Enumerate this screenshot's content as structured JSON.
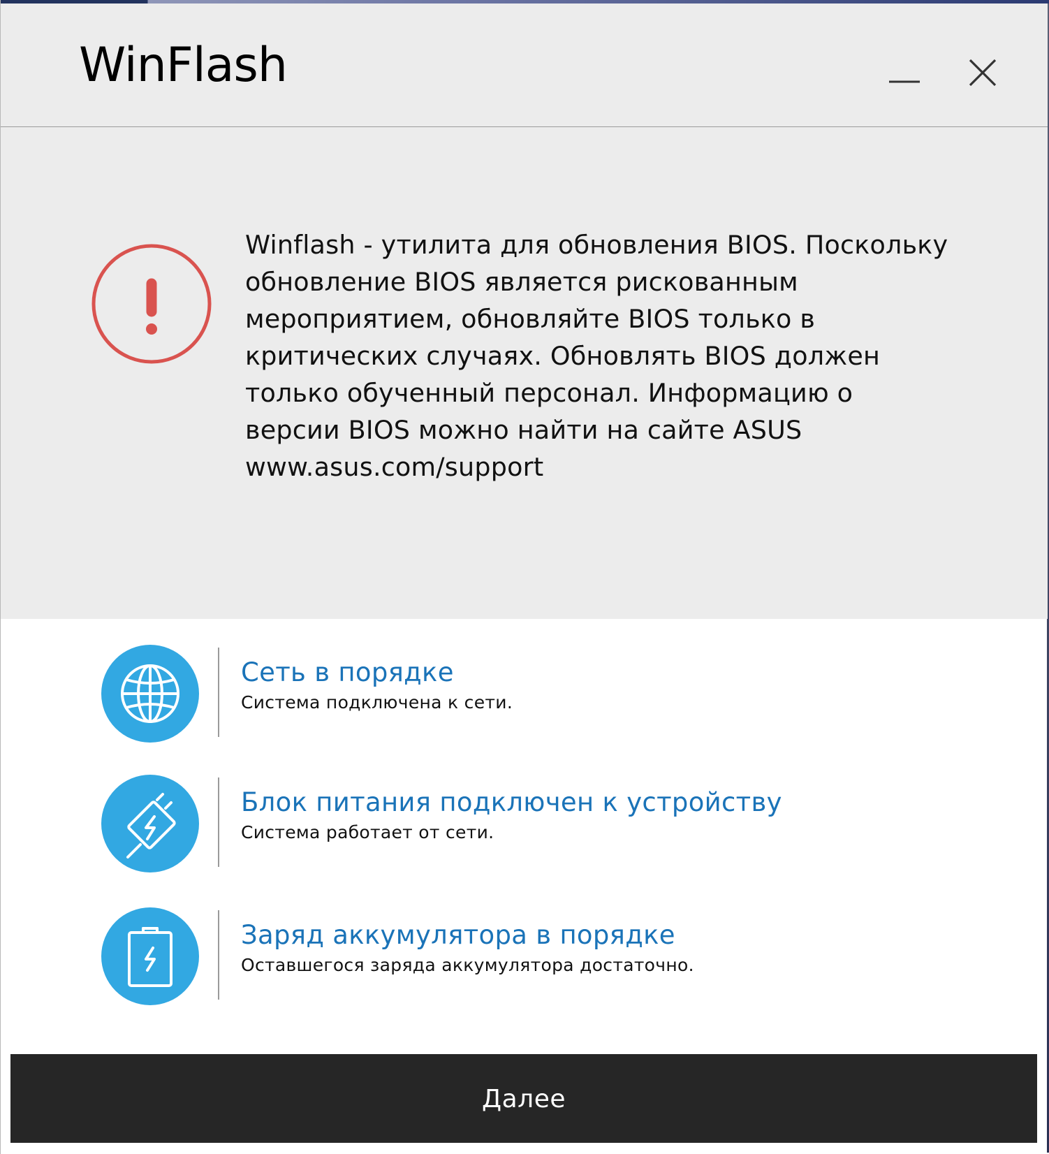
{
  "window": {
    "title": "WinFlash",
    "minimize_icon": "minimize-icon",
    "close_icon": "close-icon"
  },
  "warning": {
    "icon": "exclamation-circle-icon",
    "icon_color": "#d9534f",
    "text": "Winflash - утилита для обновления BIOS. Поскольку\nобновление BIOS является рискованным\nмероприятием, обновляйте BIOS только в\nкритических случаях. Обновлять BIOS должен\nтолько обученный персонал. Информацию о\nверсии BIOS можно найти на сайте ASUS\nwww.asus.com/support"
  },
  "status": {
    "accent_color": "#32a8e2",
    "title_color": "#1a73b8",
    "items": [
      {
        "icon": "globe-icon",
        "title": "Сеть в порядке",
        "description": "Система подключена к сети."
      },
      {
        "icon": "power-adapter-icon",
        "title": "Блок питания подключен к устройству",
        "description": "Система работает от сети."
      },
      {
        "icon": "battery-charging-icon",
        "title": "Заряд аккумулятора в порядке",
        "description": "Оставшегося заряда аккумулятора достаточно."
      }
    ]
  },
  "footer": {
    "next_label": "Далее"
  }
}
